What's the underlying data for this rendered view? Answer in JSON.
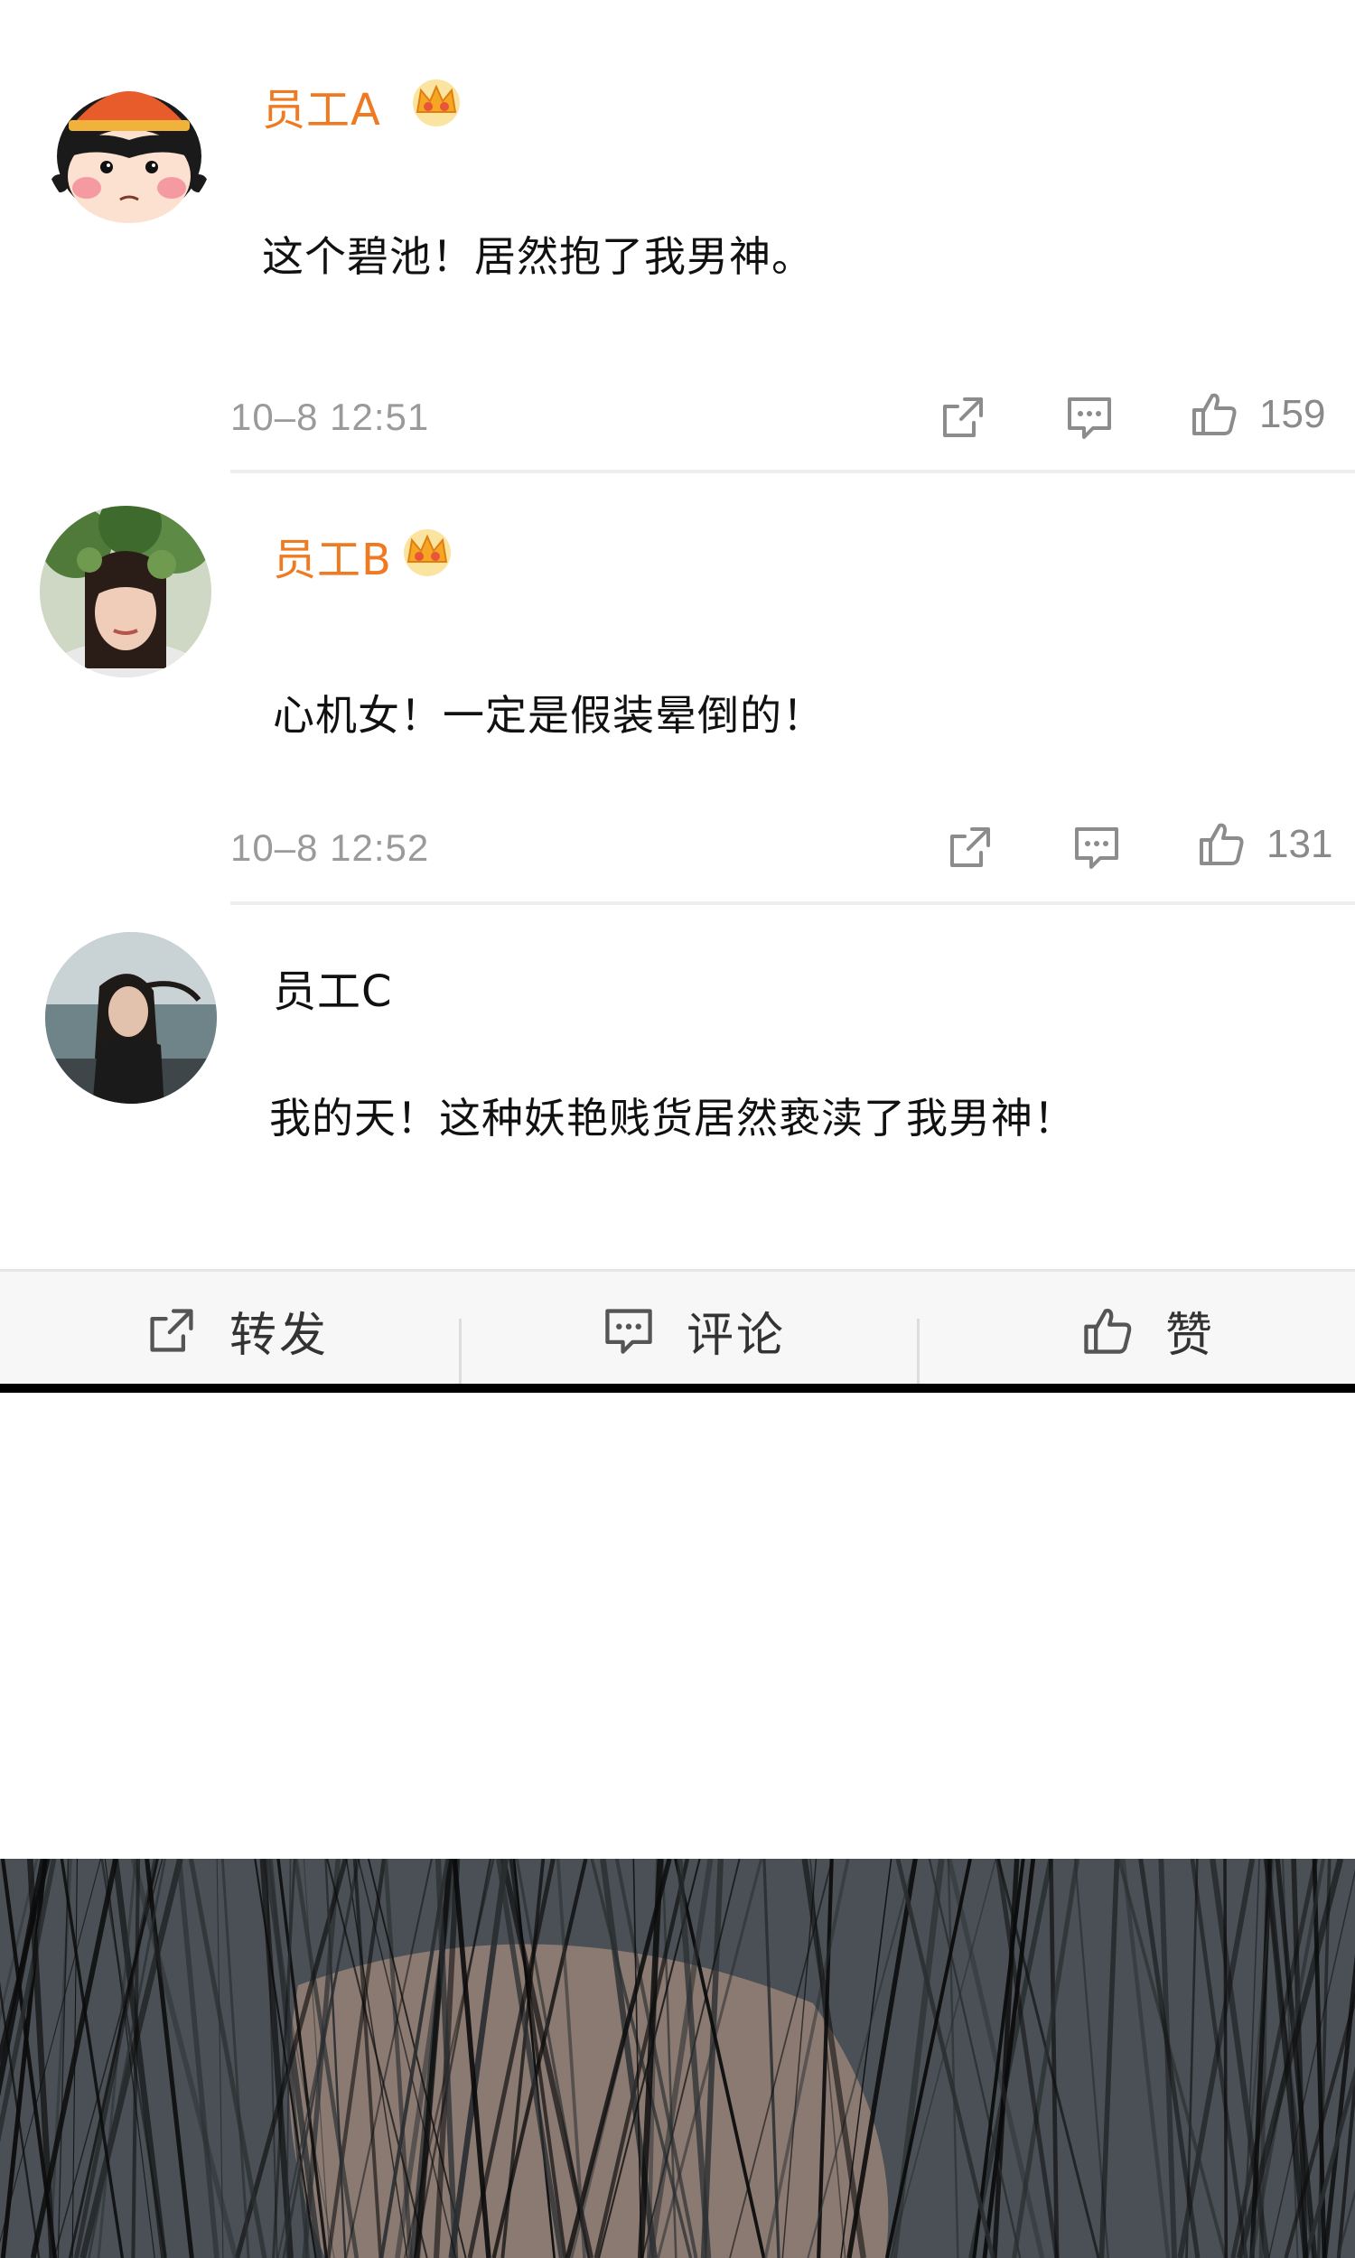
{
  "comments": [
    {
      "username": "员工A",
      "vip": true,
      "text": "这个碧池！居然抱了我男神。",
      "timestamp": "10–8 12:51",
      "likes": "159"
    },
    {
      "username": "员工B",
      "vip": true,
      "text": "心机女！一定是假装晕倒的！",
      "timestamp": "10–8 12:52",
      "likes": "131"
    },
    {
      "username": "员工C",
      "vip": false,
      "text": "我的天！这种妖艳贱货居然亵渎了我男神！"
    }
  ],
  "action_bar": {
    "repost_label": "转发",
    "comment_label": "评论",
    "like_label": "赞"
  },
  "icons": {
    "vip": "crown-icon",
    "share": "share-icon",
    "comment": "comment-icon",
    "like": "thumbs-up-icon"
  },
  "colors": {
    "vip_username": "#ef7a22",
    "meta_text": "#9a9a9a",
    "action_bar_bg": "#f7f7f7",
    "panel_border": "#000000"
  }
}
